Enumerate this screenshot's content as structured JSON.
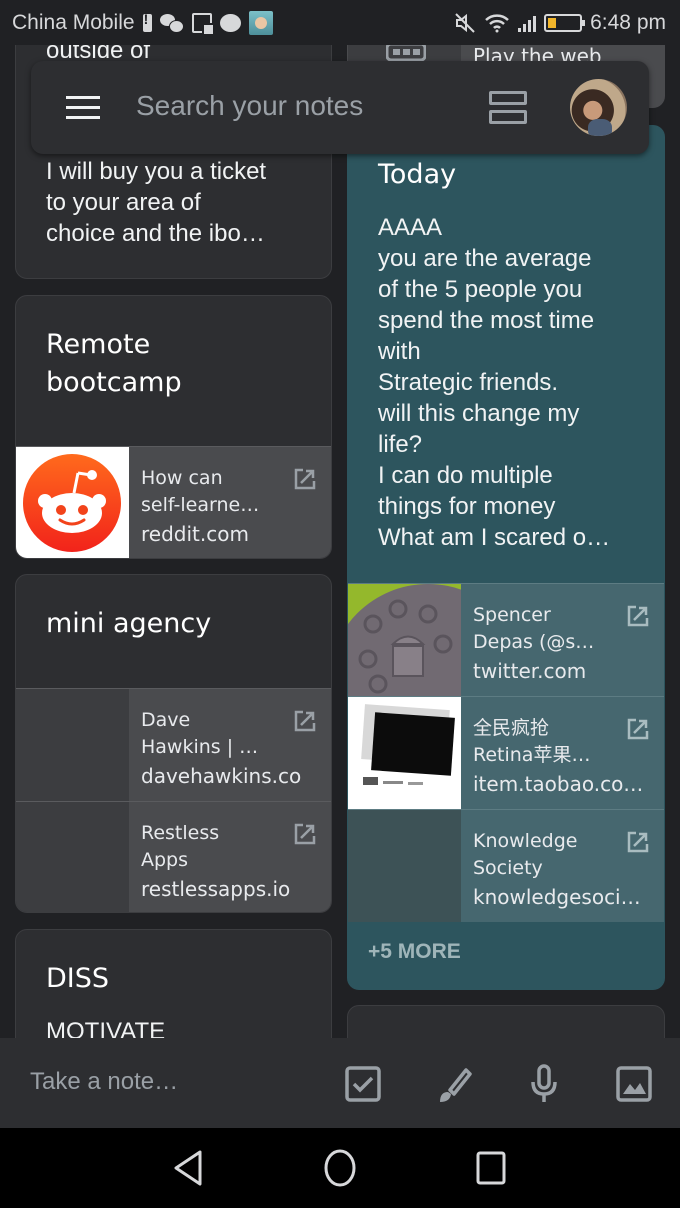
{
  "status_bar": {
    "carrier": "China Mobile",
    "time": "6:48 pm",
    "left_icons": [
      "battery-alert-icon",
      "wechat-icon",
      "document-icon",
      "message-bubble-icon",
      "app-avatar-icon"
    ],
    "right_icons": [
      "mute-icon",
      "wifi-icon",
      "signal-icon",
      "battery-icon"
    ],
    "battery_level_percent": 20
  },
  "search": {
    "placeholder": "Search your notes",
    "menu_icon": "hamburger-menu-icon",
    "view_toggle_icon": "list-view-icon",
    "avatar": "user-avatar"
  },
  "left_column": {
    "cards": [
      {
        "partial_top_text": "outside of",
        "text": "I will buy you a ticket\nto your area of\nchoice and the ibo…"
      },
      {
        "title": "Remote\nbootcamp",
        "links": [
          {
            "title": "How can\nself-learne…",
            "domain": "reddit.com",
            "thumb": "reddit-logo"
          }
        ]
      },
      {
        "title": "mini agency",
        "links": [
          {
            "title": "Dave\nHawkins | …",
            "domain": "davehawkins.co",
            "thumb": "blank"
          },
          {
            "title": "Restless\nApps",
            "domain": "restlessapps.io",
            "thumb": "blank"
          }
        ]
      },
      {
        "title": "DISS",
        "text": "MOTIVATE"
      }
    ]
  },
  "right_column": {
    "cards": [
      {
        "partial_top_text": "Play the web"
      },
      {
        "title": "Today",
        "text": "AAAA\nyou are the average\nof the 5 people you\nspend the most time\nwith\nStrategic friends.\nwill this change my\nlife?\nI can do multiple\nthings for money\nWhat am I scared o…",
        "color": "#2d555e",
        "links": [
          {
            "title": "Spencer\nDepas (@s…",
            "domain": "twitter.com",
            "thumb": "android-oreo-image"
          },
          {
            "title": "全民疯抢\nRetina苹果…",
            "domain": "item.taobao.co…",
            "thumb": "laptop-screen-image"
          },
          {
            "title": "Knowledge\nSociety",
            "domain": "knowledgesoci…",
            "thumb": "blank"
          }
        ],
        "more_label": "+5 MORE"
      }
    ]
  },
  "bottom_bar": {
    "placeholder": "Take a note…",
    "icons": [
      "checkbox-icon",
      "brush-icon",
      "microphone-icon",
      "image-icon"
    ]
  },
  "nav_bar": {
    "icons": [
      "back-icon",
      "home-icon",
      "recents-icon"
    ]
  },
  "colors": {
    "background": "#202124",
    "card": "#2d2e31",
    "teal_card": "#2d555e",
    "link_info": "#4a4b4e",
    "teal_link_info": "#46676f",
    "reddit_orange": "#ff4500"
  }
}
